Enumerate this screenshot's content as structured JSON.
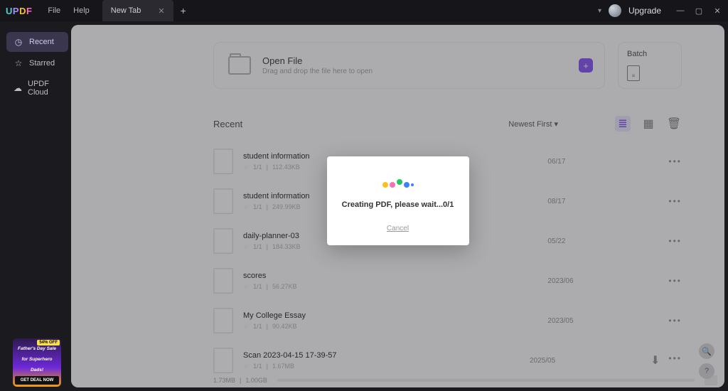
{
  "titlebar": {
    "logo": "UPDF",
    "menu": {
      "file": "File",
      "help": "Help"
    },
    "tab": "New Tab",
    "upgrade": "Upgrade"
  },
  "sidebar": {
    "recent": "Recent",
    "starred": "Starred",
    "cloud": "UPDF Cloud"
  },
  "open": {
    "title": "Open File",
    "subtitle": "Drag and drop the file here to open"
  },
  "batch": {
    "title": "Batch"
  },
  "list": {
    "title": "Recent",
    "sort": "Newest First"
  },
  "files": [
    {
      "name": "student information",
      "pages": "1/1",
      "size": "112.43KB",
      "date": "06/17"
    },
    {
      "name": "student information",
      "pages": "1/1",
      "size": "249.99KB",
      "date": "08/17"
    },
    {
      "name": "daily-planner-03",
      "pages": "1/1",
      "size": "184.33KB",
      "date": "05/22"
    },
    {
      "name": "scores",
      "pages": "1/1",
      "size": "56.27KB",
      "date": "2023/06"
    },
    {
      "name": "My College Essay",
      "pages": "1/1",
      "size": "90.42KB",
      "date": "2023/05"
    },
    {
      "name": "Scan 2023-04-15 17-39-57",
      "pages": "1/1",
      "size": "1.67MB",
      "date": "2025/05",
      "cloud": true
    }
  ],
  "status": {
    "used": "1.73MB",
    "total": "1.00GB"
  },
  "modal": {
    "text": "Creating PDF, please wait...0/1",
    "cancel": "Cancel"
  },
  "promo": {
    "badge": "54% OFF",
    "line1": "Father's Day Sale",
    "line2": "for Superhero",
    "line3": "Dads!",
    "cta": "GET DEAL NOW"
  }
}
